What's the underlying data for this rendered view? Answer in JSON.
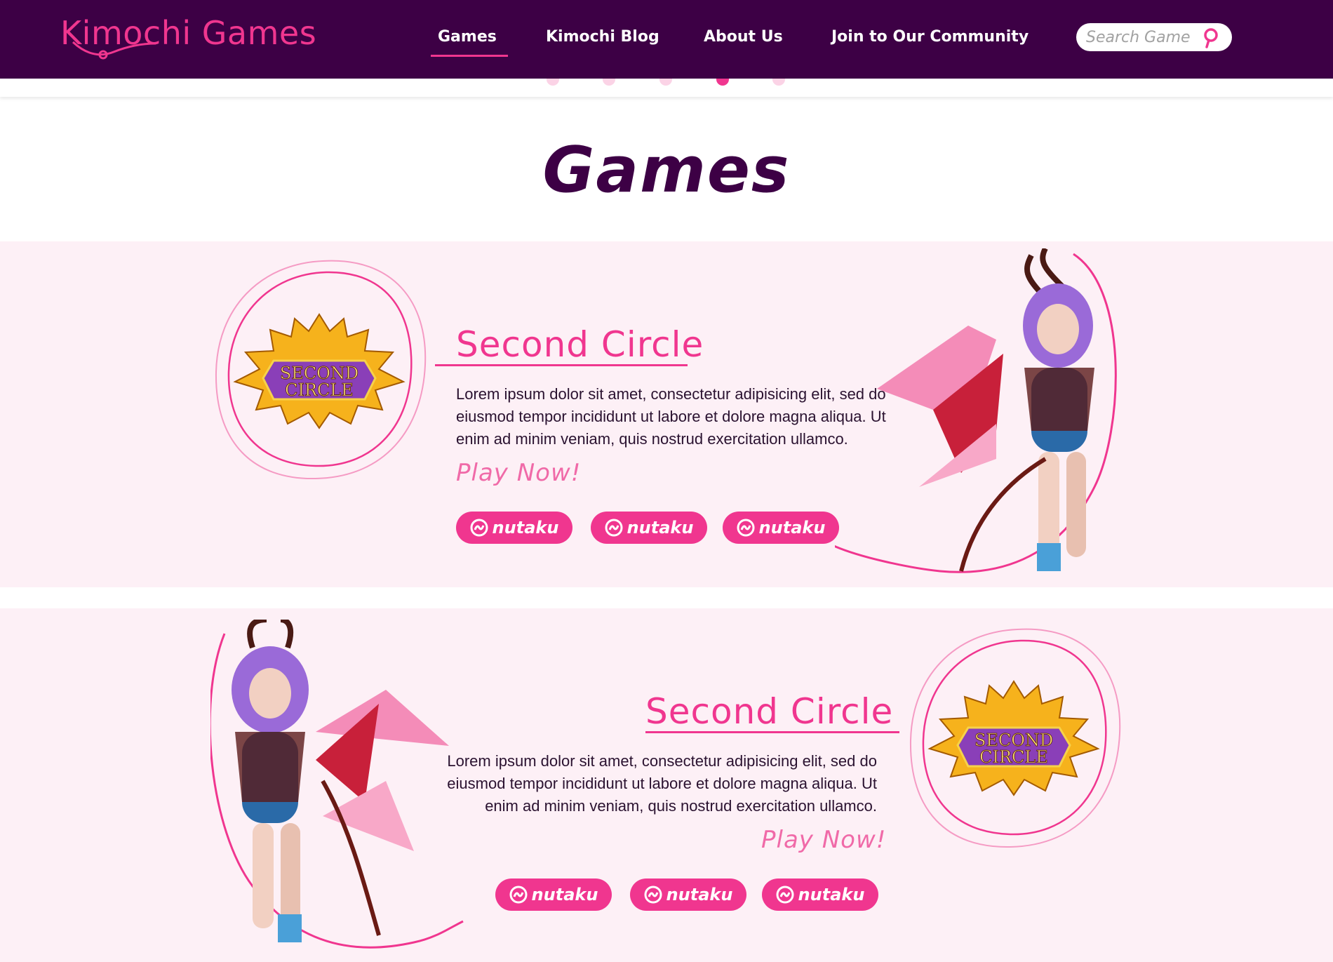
{
  "header": {
    "logo_text": "Kimochi Games",
    "nav": [
      {
        "label": "Games",
        "active": true
      },
      {
        "label": "Kimochi Blog",
        "active": false
      },
      {
        "label": "About Us",
        "active": false
      },
      {
        "label": "Join to Our Community",
        "active": false
      }
    ],
    "search": {
      "placeholder": "Search Game",
      "icon": "search-icon"
    }
  },
  "carousel": {
    "dots": 5,
    "active_index": 3
  },
  "page": {
    "title": "Games"
  },
  "games": [
    {
      "title": "Second Circle",
      "logo_lines": [
        "SECOND",
        "CIRCLE"
      ],
      "description_lines": [
        "Lorem ipsum dolor sit amet, consectetur adipisicing elit, sed do",
        "eiusmod tempor incididunt ut labore et dolore magna aliqua. Ut",
        "enim ad minim veniam, quis nostrud exercitation ullamco."
      ],
      "cta": "Play Now!",
      "buttons": [
        "nutaku",
        "nutaku",
        "nutaku"
      ],
      "layout": "logo-left"
    },
    {
      "title": "Second Circle",
      "logo_lines": [
        "SECOND",
        "CIRCLE"
      ],
      "description_lines": [
        "Lorem ipsum dolor sit amet, consectetur adipisicing elit, sed do",
        "eiusmod tempor incididunt ut labore et dolore magna aliqua. Ut",
        "enim ad minim veniam, quis nostrud exercitation ullamco."
      ],
      "cta": "Play Now!",
      "buttons": [
        "nutaku",
        "nutaku",
        "nutaku"
      ],
      "layout": "logo-right"
    }
  ],
  "colors": {
    "header_bg": "#3d0045",
    "accent": "#f0368f",
    "section_bg": "#fdf0f6",
    "title": "#3d0045"
  }
}
